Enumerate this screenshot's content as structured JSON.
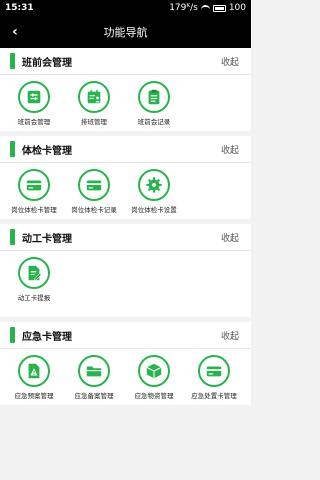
{
  "status_bar": {
    "time": "15:31",
    "network": "179ᴷ/s",
    "battery": "100"
  },
  "nav": {
    "title": "功能导航",
    "back": "‹"
  },
  "sections": [
    {
      "title": "班前会管理",
      "toggle": "收起",
      "items": [
        {
          "label": "班前会管理",
          "icon": "meeting-icon"
        },
        {
          "label": "排班管理",
          "icon": "schedule-icon"
        },
        {
          "label": "班前会记录",
          "icon": "record-icon"
        }
      ]
    },
    {
      "title": "体检卡管理",
      "toggle": "收起",
      "items": [
        {
          "label": "岗位体检卡管理",
          "icon": "card-icon"
        },
        {
          "label": "岗位体检卡记录",
          "icon": "card-icon"
        },
        {
          "label": "岗位体检卡设置",
          "icon": "gear-icon"
        }
      ]
    },
    {
      "title": "动工卡管理",
      "toggle": "收起",
      "items": [
        {
          "label": "动工卡提报",
          "icon": "edit-doc-icon"
        }
      ]
    },
    {
      "title": "应急卡管理",
      "toggle": "收起",
      "items": [
        {
          "label": "应急预案管理",
          "icon": "warning-doc-icon"
        },
        {
          "label": "应急备案管理",
          "icon": "folder-icon"
        },
        {
          "label": "应急物资管理",
          "icon": "box-icon"
        },
        {
          "label": "应急处置卡管理",
          "icon": "card-icon"
        }
      ]
    }
  ],
  "colors": {
    "accent": "#28b44c",
    "header_bg": "#000000",
    "page_bg": "#f2f2f2"
  }
}
